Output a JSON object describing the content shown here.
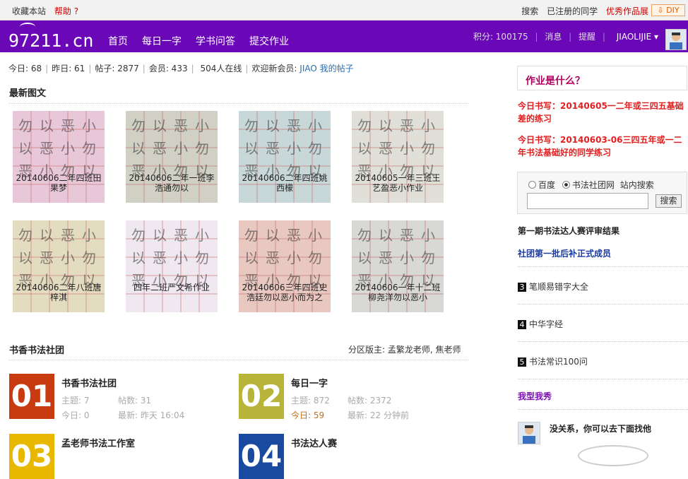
{
  "topbar": {
    "bookmark": "收藏本站",
    "help": "帮助",
    "help_arrow": "?",
    "search": "搜索",
    "registered": "已注册的同学",
    "showcase": "优秀作品展",
    "diy": "DIY"
  },
  "nav": {
    "logo": "97211.cn",
    "items": [
      "首页",
      "每日一字",
      "学书问答",
      "提交作业"
    ],
    "points": "积分: 100175",
    "messages": "消息",
    "remind": "提醒",
    "username": "JIAOLIJIE"
  },
  "stats": {
    "today": "今日: 68",
    "yesterday": "昨日: 61",
    "posts": "帖子: 2877",
    "members": "会员: 433",
    "online": "504人在线",
    "welcome": "欢迎新会员:",
    "new_member": "JIAO",
    "my_posts": "我的帖子"
  },
  "latest": {
    "title": "最新图文",
    "items": [
      {
        "caption": "20140606二年四班田果梦",
        "color": "#e8c8d8"
      },
      {
        "caption": "20140606二年一班李浩通勿以",
        "color": "#d0d0c4"
      },
      {
        "caption": "20140606二年四班姚西檬",
        "color": "#c8d8d8"
      },
      {
        "caption": "20140605一年三班王艺盈恶小作业",
        "color": "#e0e0d8"
      },
      {
        "caption": "20140606二年八班唐梓淇",
        "color": "#e4dcc0"
      },
      {
        "caption": "四年二班严文希作业",
        "color": "#f0e8f0"
      },
      {
        "caption": "20140606三年四班史浩廷勿以恶小而为之",
        "color": "#e8c8c0"
      },
      {
        "caption": "20140606一年十二班柳尧洋勿以恶小",
        "color": "#d8d8d4"
      }
    ]
  },
  "club": {
    "title": "书香书法社团",
    "moderators": "分区版主: 孟繁龙老师, 焦老师",
    "forums": [
      {
        "num": "01",
        "color": "#c83a10",
        "name": "书香书法社团",
        "topics": "主题: 7",
        "posts": "帖数: 31",
        "today": "今日: 0",
        "latest": "最新: 昨天 16:04"
      },
      {
        "num": "02",
        "color": "#b8b43a",
        "name": "每日一字",
        "topics": "主题: 872",
        "posts": "帖数: 2372",
        "today": "今日: 59",
        "latest": "最新: 22 分钟前"
      },
      {
        "num": "03",
        "color": "#e8b800",
        "name": "孟老师书法工作室"
      },
      {
        "num": "04",
        "color": "#1a4aa0",
        "name": "书法达人赛"
      }
    ]
  },
  "sidebar": {
    "homework_title": "作业是什么？",
    "link1": "今日书写：20140605一二年或三四五基础差的练习",
    "link2": "今日书写：20140603-06三四五年或一二年书法基础好的同学练习",
    "search_opt1": "百度",
    "search_opt2": "书法社团网",
    "search_opt3": "站内搜索",
    "search_btn": "搜索",
    "result": "第一期书法达人赛评审结果",
    "club_link": "社团第一批后补正式成员",
    "list": [
      {
        "n": "3",
        "text": "笔顺易错字大全"
      },
      {
        "n": "4",
        "text": "中华字经"
      },
      {
        "n": "5",
        "text": "书法常识100问"
      }
    ],
    "show": "我型我秀",
    "bottom_text": "没关系，你可以去下面找他"
  }
}
